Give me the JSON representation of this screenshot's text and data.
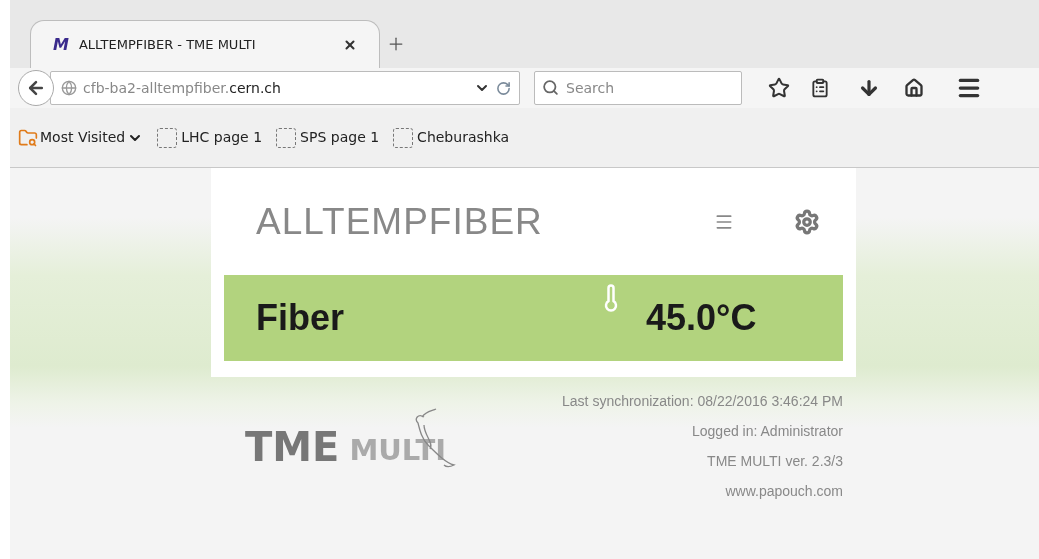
{
  "browser": {
    "tabs": [
      {
        "favicon": "M",
        "title": "ALLTEMPFIBER - TME MULTI",
        "selected": true
      }
    ],
    "url": {
      "subdomain": "cfb-ba2-alltempfiber.",
      "domain": "cern.ch"
    },
    "search": {
      "placeholder": "Search"
    },
    "bookmarks": [
      {
        "kind": "folder",
        "label": "Most Visited"
      },
      {
        "kind": "page",
        "label": "LHC page 1"
      },
      {
        "kind": "page",
        "label": "SPS page 1"
      },
      {
        "kind": "page",
        "label": "Cheburashka"
      }
    ]
  },
  "app": {
    "title": "ALLTEMPFIBER",
    "sensors": [
      {
        "name": "Fiber",
        "value": "45.0°C",
        "color": "#b2d37e"
      }
    ],
    "footer": [
      "Last synchronization: 08/22/2016 3:46:24 PM",
      "Logged in: Administrator",
      "TME MULTI ver. 2.3/3",
      "www.papouch.com"
    ],
    "logo": {
      "word_1": "TME",
      "word_2": "MULTI"
    }
  }
}
